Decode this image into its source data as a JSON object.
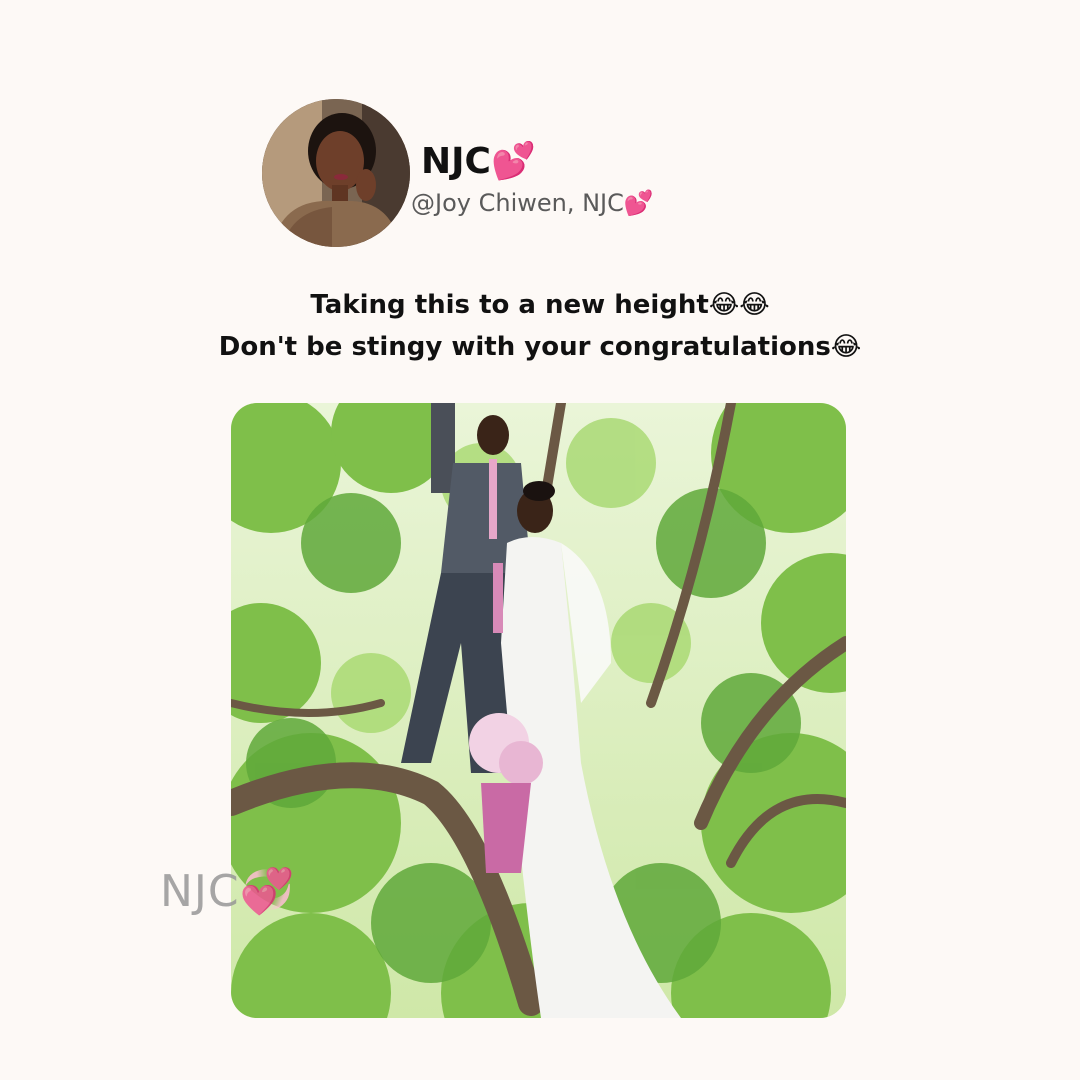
{
  "post": {
    "author_name": "NJC💕",
    "author_handle": "@Joy Chiwen, NJC💕",
    "caption_line_1": "Taking this to a new height😂😂",
    "caption_line_2": "Don't be stingy with your congratulations😂",
    "photo_watermark": "NJC💞"
  },
  "icons": {
    "avatar": "profile-photo",
    "post_image": "wedding-couple-in-tree-photo"
  }
}
